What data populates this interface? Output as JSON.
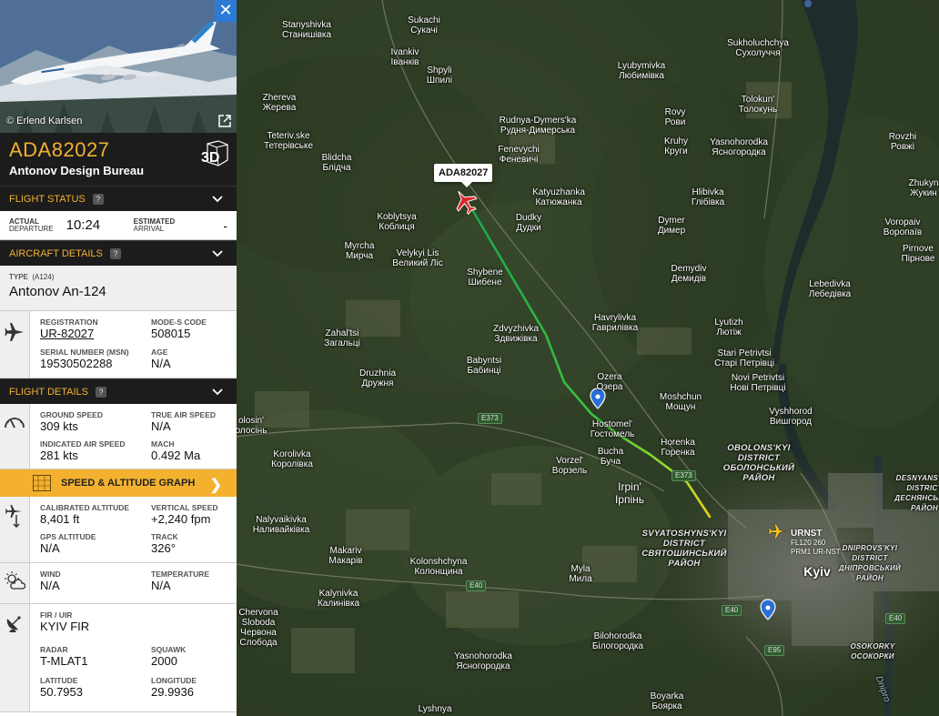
{
  "flight": {
    "callsign": "ADA82027",
    "airline": "Antonov Design Bureau",
    "photo_credit": "© Erlend Karlsen",
    "btn_3d": "3D",
    "close_symbol": "✕"
  },
  "flight_status": {
    "title": "FLIGHT STATUS",
    "help": "?",
    "actual_departure_label_1": "ACTUAL",
    "actual_departure_label_2": "DEPARTURE",
    "actual_departure_time": "10:24",
    "estimated_arrival_label_1": "ESTIMATED",
    "estimated_arrival_label_2": "ARRIVAL",
    "estimated_arrival_time": "-"
  },
  "aircraft_details": {
    "title": "AIRCRAFT DETAILS",
    "help": "?",
    "type_label": "TYPE",
    "type_code": "(A124)",
    "model": "Antonov An-124",
    "registration_label": "REGISTRATION",
    "registration": "UR-82027",
    "modes_label": "MODE-S CODE",
    "modes": "508015",
    "serial_label": "SERIAL NUMBER (MSN)",
    "serial": "19530502288",
    "age_label": "AGE",
    "age": "N/A"
  },
  "flight_details": {
    "title": "FLIGHT DETAILS",
    "help": "?",
    "ground_speed_label": "GROUND SPEED",
    "ground_speed": "309 kts",
    "true_air_speed_label": "TRUE AIR SPEED",
    "true_air_speed": "N/A",
    "ias_label": "INDICATED AIR SPEED",
    "ias": "281 kts",
    "mach_label": "MACH",
    "mach": "0.492 Ma",
    "graph_button": "SPEED & ALTITUDE GRAPH",
    "cal_alt_label": "CALIBRATED ALTITUDE",
    "cal_alt": "8,401 ft",
    "vs_label": "VERTICAL SPEED",
    "vs": "+2,240 fpm",
    "gps_alt_label": "GPS ALTITUDE",
    "gps_alt": "N/A",
    "track_label": "TRACK",
    "track": "326°",
    "wind_label": "WIND",
    "wind": "N/A",
    "temp_label": "TEMPERATURE",
    "temp": "N/A",
    "fir_label": "FIR / UIR",
    "fir": "KYIV FIR",
    "radar_label": "RADAR",
    "radar": "T-MLAT1",
    "squawk_label": "SQUAWK",
    "squawk": "2000",
    "lat_label": "LATITUDE",
    "lat": "50.7953",
    "lon_label": "LONGITUDE",
    "lon": "29.9936"
  },
  "map": {
    "selected_callout": "ADA82027",
    "other_flight_callsign": "URNST",
    "other_flight_level": "FL120 260",
    "other_flight_route": "PRM1 UR-NST",
    "places": [
      {
        "n": "Stanyshivka\nСтанишівка"
      },
      {
        "n": "Sukachi\nСукачі"
      },
      {
        "n": "Ivankiv\nІванків"
      },
      {
        "n": "Shpyli\nШпилі"
      },
      {
        "n": "Lyubymivka\nЛюбимівка"
      },
      {
        "n": "Sukholuchchya\nСухолуччя"
      },
      {
        "n": "Zhereva\nЖерева"
      },
      {
        "n": "Teteriv.ske\nТетерівське"
      },
      {
        "n": "Blidcha\nБлідча"
      },
      {
        "n": "Rudnya-Dymers'ka\nРудня-Димерська"
      },
      {
        "n": "Fenevychi\nФеневичі"
      },
      {
        "n": "Rovy\nРови"
      },
      {
        "n": "Tolokun'\nТолокунь"
      },
      {
        "n": "Kruhy\nКруги"
      },
      {
        "n": "Yasnohorodka\nЯсногородка"
      },
      {
        "n": "Rovzhi\nРовжі"
      },
      {
        "n": "Katyuzhanka\nКатюжанка"
      },
      {
        "n": "Hlibivka\nГлібівка"
      },
      {
        "n": "Koblytsya\nКоблиця"
      },
      {
        "n": "Dudky\nДудки"
      },
      {
        "n": "Dymer\nДимер"
      },
      {
        "n": "Zhukyn\nЖукин"
      },
      {
        "n": "Voropaiv\nВоропаїв"
      },
      {
        "n": "Myrcha\nМирча"
      },
      {
        "n": "Velykyi Lis\nВеликий Ліс"
      },
      {
        "n": "Pirnove\nПірнове"
      },
      {
        "n": "Shybene\nШибене"
      },
      {
        "n": "Demydiv\nДемидів"
      },
      {
        "n": "Lebedivka\nЛебедівка"
      },
      {
        "n": "Havrylivka\nГаврилівка"
      },
      {
        "n": "Zdvyzhivka\nЗдвижівка"
      },
      {
        "n": "Lyutizh\nЛютіж"
      },
      {
        "n": "Zahal'tsi\nЗагальці"
      },
      {
        "n": "Stari Petrivtsi\nСтарі Петрівці"
      },
      {
        "n": "Babyntsi\nБабинці"
      },
      {
        "n": "Novi Petrivtsi\nНові Петрівці"
      },
      {
        "n": "Druzhnia\nДружня"
      },
      {
        "n": "Ozera\nОзера"
      },
      {
        "n": "Moshchun\nМощун"
      },
      {
        "n": "Vyshhorod\nВишгород"
      },
      {
        "n": "olosin'\nолосінь"
      },
      {
        "n": "Hostomel'\nГостомель"
      },
      {
        "n": "Horenka\nГоренка"
      },
      {
        "n": "Bucha\nБуча"
      },
      {
        "n": "Korolivka\nКоролівка"
      },
      {
        "n": "Vorzel'\nВорзель"
      },
      {
        "n": "Irpin'\nІрпінь"
      },
      {
        "n": "Nalyvaikivka\nНаливайківка"
      },
      {
        "n": "Makariv\nМакарів"
      },
      {
        "n": "Kolonshchyna\nКолонщина"
      },
      {
        "n": "Myla\nМила"
      },
      {
        "n": "Kalynivka\nКалинівка"
      },
      {
        "n": "Chervona\nSloboda\nЧервона\nСлобода"
      },
      {
        "n": "Bilohorodka\nБілогородка"
      },
      {
        "n": "Yasnohorodka\nЯсногородка"
      },
      {
        "n": "Boyarka\nБоярка"
      },
      {
        "n": "Lyshnya"
      },
      {
        "n": "Kyiv"
      },
      {
        "n": "OBOLONS'KYI\nDISTRICT\nОБОЛОНСЬКИЙ\nРАЙОН"
      },
      {
        "n": "SVYATOSHYNS'KYI\nDISTRICT\nСВЯТОШИНСЬКИЙ\nРАЙОН"
      },
      {
        "n": "DESNYANS'KYI\nDISTRICT\nДЕСНЯНСЬКИЙ\nРАЙОН"
      },
      {
        "n": "DNIPROVS'KYI\nDISTRICT\nДНІПРОВСЬКИЙ\nРАЙОН"
      },
      {
        "n": "OSOKORKY\nОСОКОРКИ"
      },
      {
        "n": "Dnipro"
      }
    ],
    "roads": [
      "E373",
      "E373",
      "E40",
      "E40",
      "E40",
      "E95"
    ]
  },
  "colors": {
    "accent": "#f3b12f",
    "header_bg": "#1c1c1c",
    "track_start": "#1aa84a",
    "track_end": "#e6d21a",
    "selected_aircraft": "#d8262a",
    "other_aircraft": "#f5c518",
    "close_button": "#2b7bd6"
  }
}
